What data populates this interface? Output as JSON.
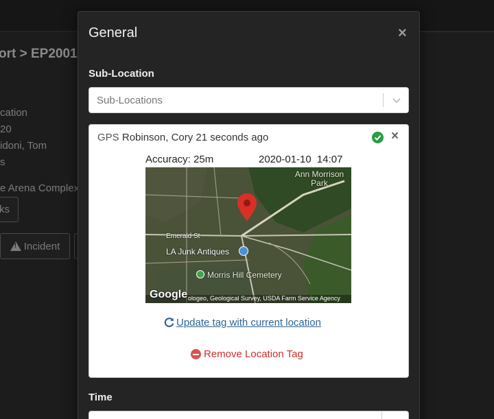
{
  "background": {
    "breadcrumb": "ort > EP2001",
    "lines": [
      "cation",
      "20",
      "idoni, Tom",
      "s",
      "e Arena Complex"
    ],
    "links_button": "ks",
    "incident_button": "Incident"
  },
  "modal": {
    "title": "General",
    "close_glyph": "×",
    "sub_location": {
      "label": "Sub-Location",
      "placeholder": "Sub-Locations"
    },
    "location_tag": {
      "source": "GPS",
      "user": "Robinson, Cory",
      "age": "21 seconds ago",
      "accuracy": "Accuracy: 25m",
      "date": "2020-01-10",
      "time": "14:07",
      "map": {
        "labels": [
          "Ann Morrison Park",
          "Emerald St",
          "LA Junk Antiques",
          "Morris Hill Cemetery"
        ],
        "logo": "Google",
        "attribution": "ologeo, Geological Survey, USDA Farm Service Agency"
      },
      "update_link": "Update tag with current location",
      "remove_link": "Remove Location Tag",
      "close_glyph": "×"
    },
    "time": {
      "label": "Time"
    }
  },
  "colors": {
    "accent_link": "#2a6496",
    "danger": "#c9302c",
    "success": "#2e9c47",
    "marker": "#d93025"
  }
}
